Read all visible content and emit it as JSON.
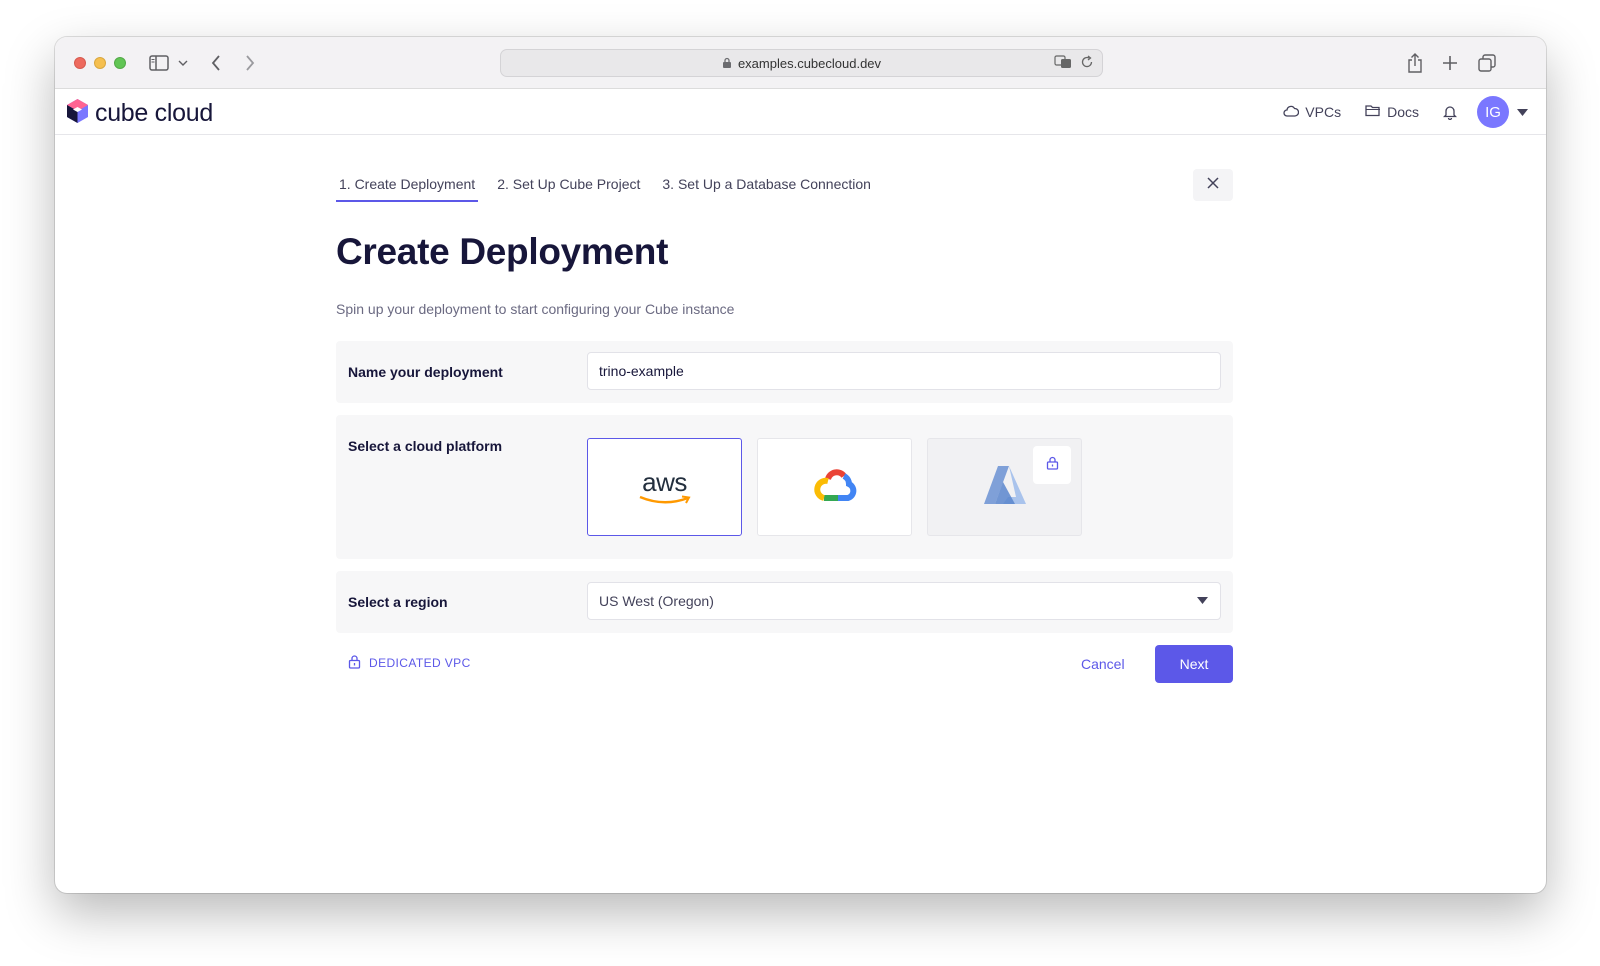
{
  "browser": {
    "url": "examples.cubecloud.dev"
  },
  "header": {
    "logo_text": "cube cloud",
    "nav": [
      {
        "label": "VPCs",
        "icon": "cloud-icon"
      },
      {
        "label": "Docs",
        "icon": "folder-icon"
      }
    ],
    "avatar_initials": "IG"
  },
  "steps": [
    {
      "label": "1. Create Deployment",
      "active": true
    },
    {
      "label": "2. Set Up Cube Project",
      "active": false
    },
    {
      "label": "3. Set Up a Database Connection",
      "active": false
    }
  ],
  "page": {
    "title": "Create Deployment",
    "subtitle": "Spin up your deployment to start configuring your Cube instance"
  },
  "form": {
    "name_label": "Name your deployment",
    "name_value": "trino-example",
    "cloud_label": "Select a cloud platform",
    "cloud_options": [
      {
        "id": "aws",
        "text": "aws",
        "selected": true,
        "locked": false
      },
      {
        "id": "gcp",
        "selected": false,
        "locked": false
      },
      {
        "id": "azure",
        "selected": false,
        "locked": true
      }
    ],
    "region_label": "Select a region",
    "region_value": "US West (Oregon)"
  },
  "actions": {
    "vpc_label": "DEDICATED VPC",
    "cancel_label": "Cancel",
    "next_label": "Next"
  },
  "colors": {
    "accent": "#5c58e8",
    "heading": "#17163a",
    "avatar": "#7a77ff"
  }
}
